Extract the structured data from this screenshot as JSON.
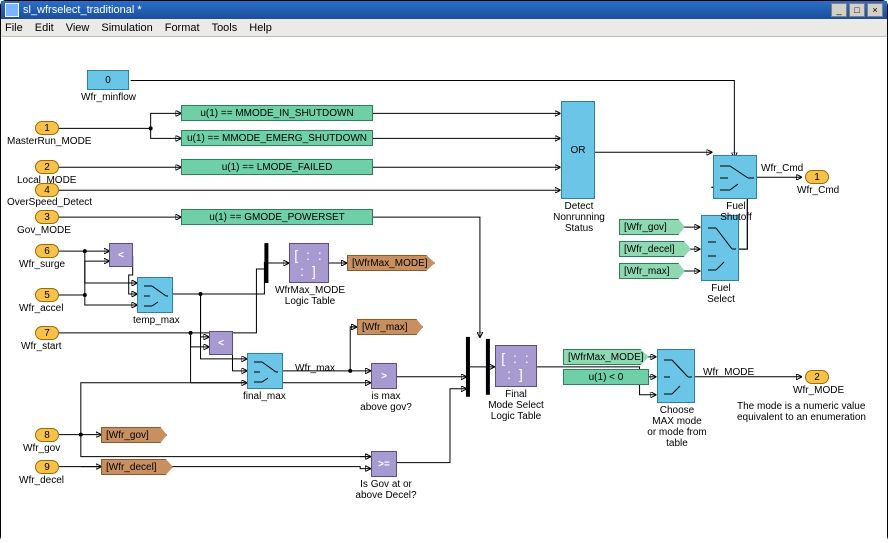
{
  "window": {
    "title": "sl_wfrselect_traditional *"
  },
  "menu": {
    "items": [
      "File",
      "Edit",
      "View",
      "Simulation",
      "Format",
      "Tools",
      "Help"
    ]
  },
  "titlebuttons": {
    "min": "_",
    "max": "□",
    "close": "×"
  },
  "blocks": {
    "const_minflow": "0",
    "inports": {
      "p1": "1",
      "p2": "2",
      "p3": "3",
      "p4": "4",
      "p5": "5",
      "p6": "6",
      "p7": "7",
      "p8": "8",
      "p9": "9"
    },
    "inport_labels": {
      "p1": "MasterRun_MODE",
      "p2": "Local_MODE",
      "p3": "Gov_MODE",
      "p4": "OverSpeed_Detect",
      "p5": "Wfr_accel",
      "p6": "Wfr_surge",
      "p7": "Wfr_start",
      "p8": "Wfr_gov",
      "p9": "Wfr_decel"
    },
    "green1": "u(1) == MMODE_IN_SHUTDOWN",
    "green2": "u(1) == MMODE_EMERG_SHUTDOWN",
    "green3": "u(1) == LMODE_FAILED",
    "green4": "u(1) == GMODE_POWERSET",
    "green5": "u(1) < 0",
    "or_label": "OR",
    "detect_label": "Detect\nNonrunning\nStatus",
    "const_minflow_label": "Wfr_minflow",
    "temp_max_label": "temp_max",
    "final_max_label": "final_max",
    "wfr_max_signal": "Wfr_max",
    "wfrmax_mode_label": "WfrMax_MODE\nLogic Table",
    "wfrmax_mode_glyph": "[ : : : ]",
    "ismax_label": "is max\nabove gov?",
    "isgov_label": "Is Gov at or\nabove Decel?",
    "final_mode_label": "Final\nMode Select\nLogic Table",
    "final_mode_glyph": "[ : : : ]",
    "fuel_select_label": "Fuel\nSelect",
    "fuel_shutoff_label": "Fuel\nShutoff",
    "choose_label": "Choose\nMAX mode\nor mode from\ntable",
    "relops": {
      "lt": "<",
      "lt2": "<",
      "gt": ">",
      "gte": ">="
    },
    "goto": {
      "wfrmax_mode": "[WfrMax_MODE]",
      "wfr_max": "[Wfr_max]"
    },
    "from": {
      "wfr_gov": "[Wfr_gov]",
      "wfr_decel": "[Wfr_decel]",
      "wfr_gov2": "[Wfr_gov]",
      "wfr_decel2": "[Wfr_decel]",
      "wfr_max2": "[Wfr_max]",
      "wfrmax_mode2": "[WfrMax_MODE]"
    },
    "outports": {
      "o1": "1",
      "o2": "2"
    },
    "outport_labels": {
      "o1": "Wfr_Cmd",
      "o2": "Wfr_MODE"
    },
    "signal_wfrCmd": "Wfr_Cmd",
    "signal_wfrMode": "Wfr_MODE",
    "note_text": "The mode is a numeric value\nequivalent to an enumeration"
  }
}
